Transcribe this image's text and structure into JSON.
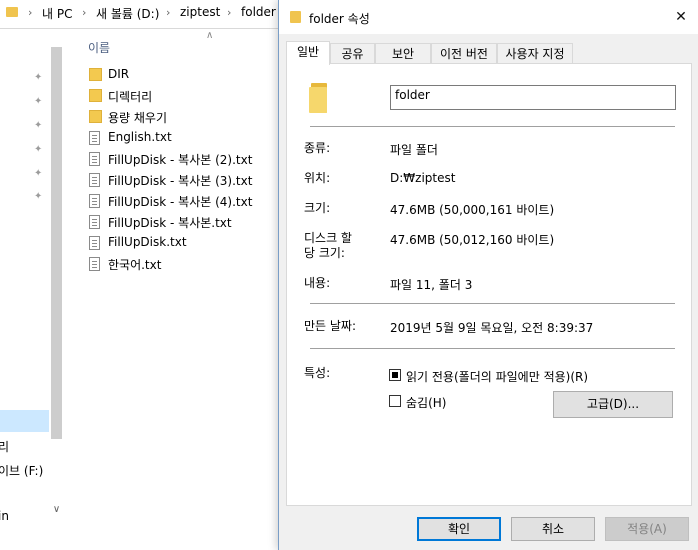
{
  "explorer": {
    "breadcrumb": [
      "내 PC",
      "새 볼륨 (D:)",
      "ziptest",
      "folder"
    ],
    "column_header": "이름",
    "files": [
      {
        "name": "DIR",
        "type": "folder"
      },
      {
        "name": "디렉터리",
        "type": "folder"
      },
      {
        "name": "용량 채우기",
        "type": "folder"
      },
      {
        "name": "English.txt",
        "type": "file"
      },
      {
        "name": "FillUpDisk - 복사본 (2).txt",
        "type": "file"
      },
      {
        "name": "FillUpDisk - 복사본 (3).txt",
        "type": "file"
      },
      {
        "name": "FillUpDisk - 복사본 (4).txt",
        "type": "file"
      },
      {
        "name": "FillUpDisk - 복사본.txt",
        "type": "file"
      },
      {
        "name": "FillUpDisk.txt",
        "type": "file"
      },
      {
        "name": "한국어.txt",
        "type": "file"
      }
    ],
    "nav_labels": [
      "리",
      "이브 (F:)",
      "in"
    ]
  },
  "dialog": {
    "title": "folder 속성",
    "close_glyph": "✕",
    "tabs": [
      "일반",
      "공유",
      "보안",
      "이전 버전",
      "사용자 지정"
    ],
    "active_tab": "일반",
    "name_value": "folder",
    "properties": {
      "type_label": "종류:",
      "type_value": "파일 폴더",
      "location_label": "위치:",
      "location_value": "D:₩ziptest",
      "size_label": "크기:",
      "size_value": "47.6MB (50,000,161 바이트)",
      "disk_size_label": "디스크 할\n당 크기:",
      "disk_size_value": "47.6MB (50,012,160 바이트)",
      "contains_label": "내용:",
      "contains_value": "파일 11, 폴더 3",
      "created_label": "만든 날짜:",
      "created_value": "2019년 5월 9일 목요일, 오전 8:39:37",
      "attributes_label": "특성:"
    },
    "attributes": {
      "readonly_label": "읽기 전용(폴더의 파일에만 적용)(R)",
      "readonly_checked": true,
      "hidden_label": "숨김(H)",
      "hidden_checked": false,
      "advanced_label": "고급(D)..."
    },
    "buttons": {
      "ok": "확인",
      "cancel": "취소",
      "apply": "적용(A)"
    }
  },
  "colors": {
    "accent": "#0078d7",
    "folder": "#f3c94f",
    "selection": "#cce8ff"
  }
}
